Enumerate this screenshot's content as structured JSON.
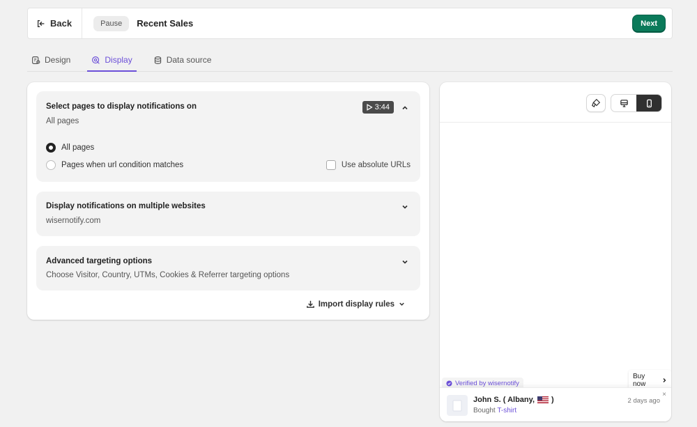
{
  "header": {
    "back_label": "Back",
    "pause_label": "Pause",
    "title": "Recent Sales",
    "next_label": "Next"
  },
  "tabs": [
    {
      "label": "Design",
      "icon": "design-icon"
    },
    {
      "label": "Display",
      "icon": "display-icon",
      "active": true
    },
    {
      "label": "Data source",
      "icon": "database-icon"
    }
  ],
  "sections": {
    "pages": {
      "title": "Select pages to display notifications on",
      "subtitle": "All pages",
      "video_duration": "3:44",
      "options": [
        "All pages",
        "Pages when url condition matches"
      ],
      "selected": "All pages",
      "absolute_urls_label": "Use absolute URLs"
    },
    "websites": {
      "title": "Display notifications on multiple websites",
      "subtitle": "wisernotify.com"
    },
    "advanced": {
      "title": "Advanced targeting options",
      "subtitle": "Choose Visitor, Country, UTMs, Cookies & Referrer targeting options"
    },
    "import_label": "Import display rules"
  },
  "preview": {
    "buy_now_label": "Buy now",
    "verified_label": "Verified by wisernotify",
    "notification": {
      "name": "John S. ( Albany,",
      "name_end": ")",
      "action": "Bought",
      "product": "T-shirt",
      "time": "2 days ago",
      "close": "×"
    }
  },
  "colors": {
    "accent": "#6b4fd8",
    "primary_button": "#0b7a5a"
  }
}
